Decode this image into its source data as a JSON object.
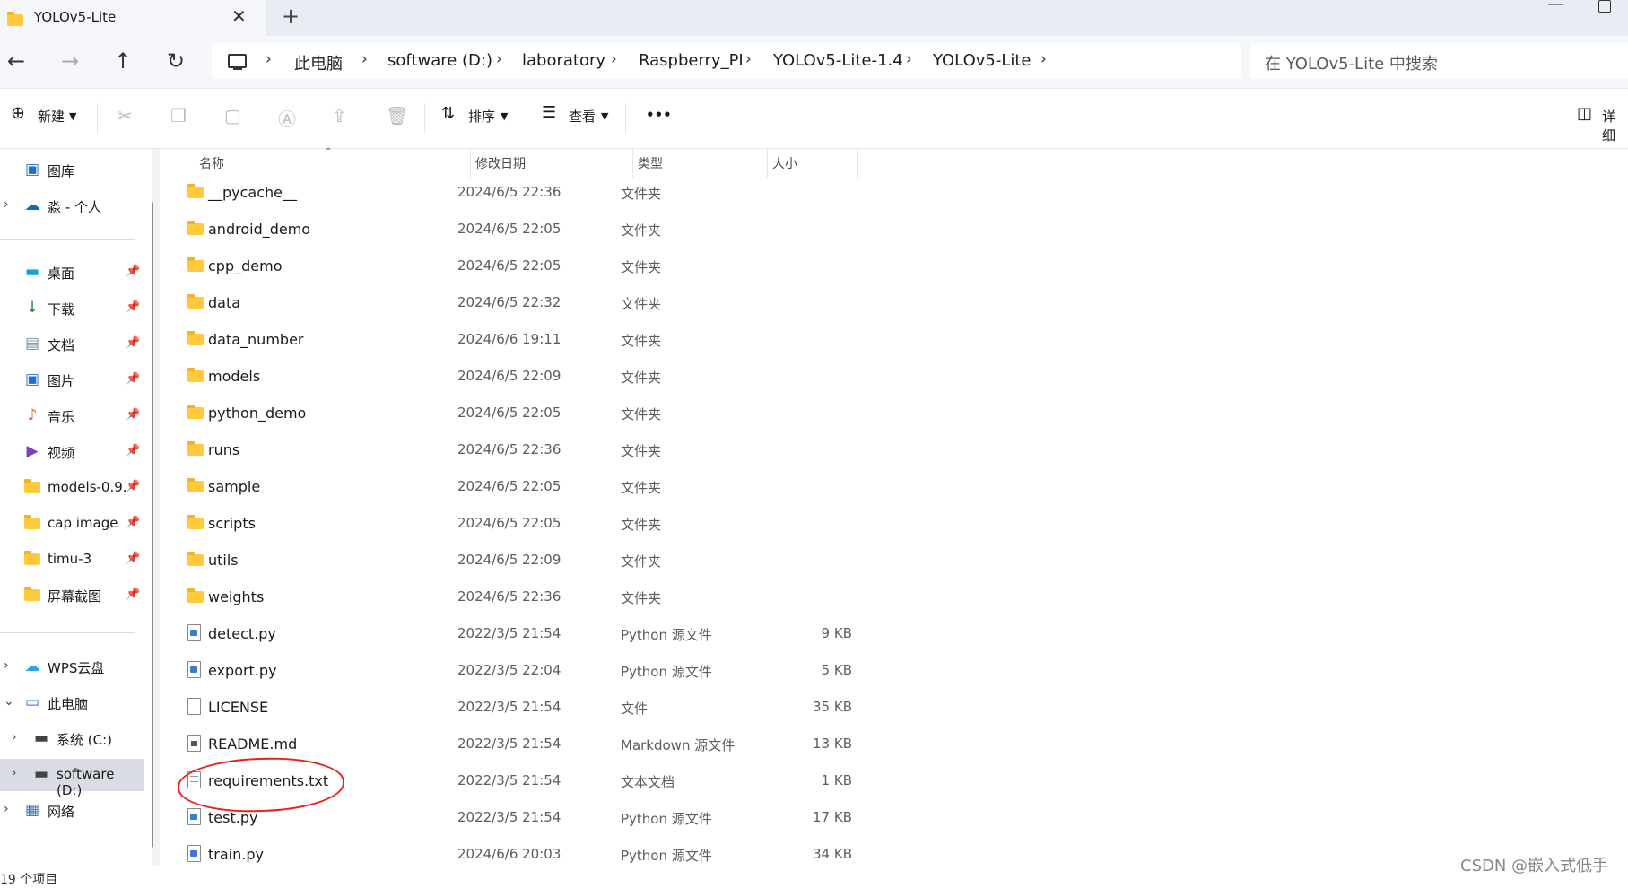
{
  "window": {
    "tab_title": "YOLOv5-Lite",
    "tab_close": "✕",
    "new_tab": "+"
  },
  "nav": {
    "back": "←",
    "forward": "→",
    "up": "↑",
    "refresh": "↻"
  },
  "breadcrumb": [
    "此电脑",
    "software (D:)",
    "laboratory",
    "Raspberry_PI",
    "YOLOv5-Lite-1.4",
    "YOLOv5-Lite"
  ],
  "search": {
    "placeholder": "在 YOLOv5-Lite 中搜索"
  },
  "toolbar": {
    "new_label": "新建",
    "sort_label": "排序",
    "view_label": "查看",
    "more_label": "•••",
    "details_label": "详细"
  },
  "sidebar": {
    "top": [
      {
        "label": "图库",
        "icon": "gallery-icon"
      },
      {
        "label": "淼 - 个人",
        "icon": "onedrive-icon"
      }
    ],
    "quick": [
      {
        "label": "桌面",
        "icon": "desktop-icon"
      },
      {
        "label": "下载",
        "icon": "download-icon"
      },
      {
        "label": "文档",
        "icon": "documents-icon"
      },
      {
        "label": "图片",
        "icon": "pictures-icon"
      },
      {
        "label": "音乐",
        "icon": "music-icon"
      },
      {
        "label": "视频",
        "icon": "videos-icon"
      },
      {
        "label": "models-0.9.",
        "icon": "folder-icon"
      },
      {
        "label": "cap image",
        "icon": "folder-icon"
      },
      {
        "label": "timu-3",
        "icon": "folder-icon"
      },
      {
        "label": "屏幕截图",
        "icon": "folder-icon"
      }
    ],
    "bottom": [
      {
        "label": "WPS云盘",
        "icon": "wps-cloud-icon"
      },
      {
        "label": "此电脑",
        "icon": "this-pc-icon"
      },
      {
        "label": "系统 (C:)",
        "icon": "drive-icon"
      },
      {
        "label": "software (D:)",
        "icon": "drive-icon"
      },
      {
        "label": "网络",
        "icon": "network-icon"
      }
    ]
  },
  "columns": {
    "name": "名称",
    "date": "修改日期",
    "type": "类型",
    "size": "大小"
  },
  "files": [
    {
      "name": "__pycache__",
      "date": "2024/6/5 22:36",
      "type": "文件夹",
      "size": "",
      "kind": "folder"
    },
    {
      "name": "android_demo",
      "date": "2024/6/5 22:05",
      "type": "文件夹",
      "size": "",
      "kind": "folder"
    },
    {
      "name": "cpp_demo",
      "date": "2024/6/5 22:05",
      "type": "文件夹",
      "size": "",
      "kind": "folder"
    },
    {
      "name": "data",
      "date": "2024/6/5 22:32",
      "type": "文件夹",
      "size": "",
      "kind": "folder"
    },
    {
      "name": "data_number",
      "date": "2024/6/6 19:11",
      "type": "文件夹",
      "size": "",
      "kind": "folder"
    },
    {
      "name": "models",
      "date": "2024/6/5 22:09",
      "type": "文件夹",
      "size": "",
      "kind": "folder"
    },
    {
      "name": "python_demo",
      "date": "2024/6/5 22:05",
      "type": "文件夹",
      "size": "",
      "kind": "folder"
    },
    {
      "name": "runs",
      "date": "2024/6/5 22:36",
      "type": "文件夹",
      "size": "",
      "kind": "folder"
    },
    {
      "name": "sample",
      "date": "2024/6/5 22:05",
      "type": "文件夹",
      "size": "",
      "kind": "folder"
    },
    {
      "name": "scripts",
      "date": "2024/6/5 22:05",
      "type": "文件夹",
      "size": "",
      "kind": "folder"
    },
    {
      "name": "utils",
      "date": "2024/6/5 22:09",
      "type": "文件夹",
      "size": "",
      "kind": "folder"
    },
    {
      "name": "weights",
      "date": "2024/6/5 22:36",
      "type": "文件夹",
      "size": "",
      "kind": "folder"
    },
    {
      "name": "detect.py",
      "date": "2022/3/5 21:54",
      "type": "Python 源文件",
      "size": "9 KB",
      "kind": "py"
    },
    {
      "name": "export.py",
      "date": "2022/3/5 22:04",
      "type": "Python 源文件",
      "size": "5 KB",
      "kind": "py"
    },
    {
      "name": "LICENSE",
      "date": "2022/3/5 21:54",
      "type": "文件",
      "size": "35 KB",
      "kind": "file"
    },
    {
      "name": "README.md",
      "date": "2022/3/5 21:54",
      "type": "Markdown 源文件",
      "size": "13 KB",
      "kind": "md"
    },
    {
      "name": "requirements.txt",
      "date": "2022/3/5 21:54",
      "type": "文本文档",
      "size": "1 KB",
      "kind": "txt"
    },
    {
      "name": "test.py",
      "date": "2022/3/5 21:54",
      "type": "Python 源文件",
      "size": "17 KB",
      "kind": "py"
    },
    {
      "name": "train.py",
      "date": "2024/6/6 20:03",
      "type": "Python 源文件",
      "size": "34 KB",
      "kind": "py"
    }
  ],
  "status": {
    "count": "19 个项目"
  },
  "watermark": "CSDN @嵌入式低手",
  "colors": {
    "folder": "#ffc83d",
    "selection": "#d9dde3",
    "annotation": "#e8221b"
  }
}
